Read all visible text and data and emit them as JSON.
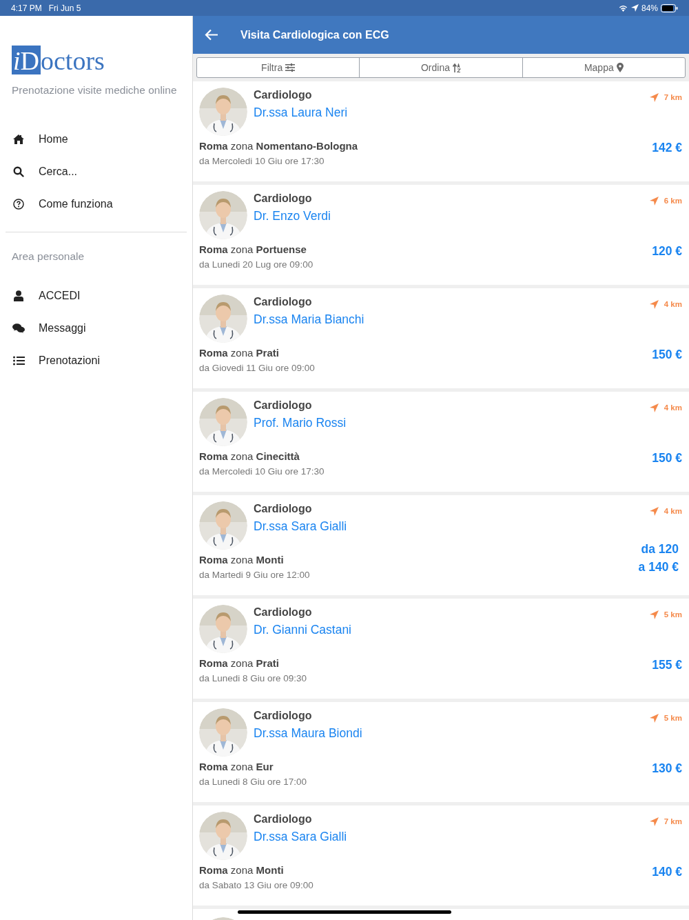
{
  "status_bar": {
    "time": "4:17 PM",
    "date": "Fri Jun 5",
    "battery": "84%"
  },
  "sidebar": {
    "logo": {
      "badge": [
        "i",
        "D"
      ],
      "text": "octors"
    },
    "tagline": "Prenotazione visite mediche online",
    "items": [
      {
        "label": "Home"
      },
      {
        "label": "Cerca..."
      },
      {
        "label": "Come funziona"
      }
    ],
    "section_title": "Area personale",
    "personal_items": [
      {
        "label": "ACCEDI"
      },
      {
        "label": "Messaggi"
      },
      {
        "label": "Prenotazioni"
      }
    ]
  },
  "header": {
    "title": "Visita Cardiologica con ECG"
  },
  "toolbar": [
    {
      "label": "Filtra"
    },
    {
      "label": "Ordina"
    },
    {
      "label": "Mappa"
    }
  ],
  "doctors": [
    {
      "specialty": "Cardiologo",
      "name": "Dr.ssa Laura Neri",
      "distance": "7 km",
      "location": "**Roma** zona **Nomentano-Bologna**",
      "availability": "da Mercoledi 10 Giu ore 17:30",
      "price": [
        "142 €"
      ]
    },
    {
      "specialty": "Cardiologo",
      "name": "Dr. Enzo Verdi",
      "distance": "6 km",
      "location": "**Roma** zona **Portuense**",
      "availability": "da Lunedi 20 Lug ore 09:00",
      "price": [
        "120 €"
      ]
    },
    {
      "specialty": "Cardiologo",
      "name": "Dr.ssa Maria Bianchi",
      "distance": "4 km",
      "location": "**Roma** zona **Prati**",
      "availability": "da Giovedi 11 Giu ore 09:00",
      "price": [
        "150 €"
      ]
    },
    {
      "specialty": "Cardiologo",
      "name": "Prof. Mario Rossi",
      "distance": "4 km",
      "location": "**Roma** zona **Cinecittà**",
      "availability": "da Mercoledi 10 Giu ore 17:30",
      "price": [
        "150 €"
      ]
    },
    {
      "specialty": "Cardiologo",
      "name": "Dr.ssa Sara Gialli",
      "distance": "4 km",
      "location": "**Roma** zona **Monti**",
      "availability": "da Martedi 9 Giu ore 12:00",
      "price": [
        "da 120",
        "a 140 €"
      ]
    },
    {
      "specialty": "Cardiologo",
      "name": "Dr. Gianni Castani",
      "distance": "5 km",
      "location": "**Roma** zona **Prati**",
      "availability": "da Lunedi 8 Giu ore 09:30",
      "price": [
        "155 €"
      ]
    },
    {
      "specialty": "Cardiologo",
      "name": "Dr.ssa Maura Biondi",
      "distance": "5 km",
      "location": "**Roma** zona **Eur**",
      "availability": "da Lunedi 8 Giu ore 17:00",
      "price": [
        "130 €"
      ]
    },
    {
      "specialty": "Cardiologo",
      "name": "Dr.ssa Sara Gialli",
      "distance": "7 km",
      "location": "**Roma** zona **Monti**",
      "availability": "da Sabato 13 Giu ore 09:00",
      "price": [
        "140 €"
      ]
    }
  ]
}
